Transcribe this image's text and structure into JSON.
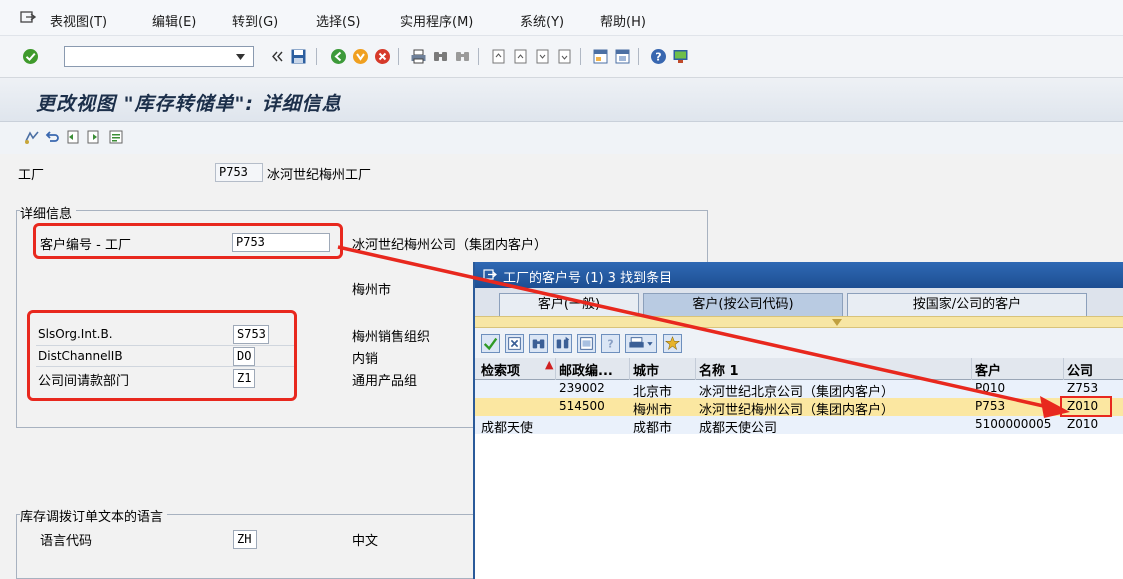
{
  "menu": {
    "items": [
      "表视图(T)",
      "编辑(E)",
      "转到(G)",
      "选择(S)",
      "实用程序(M)",
      "系统(Y)",
      "帮助(H)"
    ]
  },
  "toolbar": {
    "command_value": ""
  },
  "title": "更改视图 \"库存转储单\": 详细信息",
  "plant": {
    "label": "工厂",
    "value": "P753",
    "desc": "冰河世纪梅州工厂"
  },
  "details": {
    "group_title": "详细信息",
    "customer": {
      "label": "客户编号 - 工厂",
      "value": "P753",
      "desc": "冰河世纪梅州公司（集团内客户）",
      "city": "梅州市"
    },
    "salesorg": {
      "label": "SlsOrg.Int.B.",
      "value": "S753",
      "desc": "梅州销售组织"
    },
    "distchannel": {
      "label": "DistChannelIB",
      "value": "DO",
      "desc": "内销"
    },
    "division": {
      "label": "公司间请款部门",
      "value": "Z1",
      "desc": "通用产品组"
    }
  },
  "language": {
    "group_title": "库存调拨订单文本的语言",
    "label": "语言代码",
    "value": "ZH",
    "desc": "中文"
  },
  "popup": {
    "title": "工厂的客户号 (1)   3 找到条目",
    "tabs": [
      "客户(一般)",
      "客户(按公司代码)",
      "按国家/公司的客户"
    ],
    "columns": [
      "检索项",
      "邮政编...",
      "城市",
      "名称 1",
      "客户",
      "公司"
    ],
    "rows": [
      {
        "search": "",
        "postal": "239002",
        "city": "北京市",
        "name": "冰河世纪北京公司（集团内客户）",
        "customer": "P010",
        "company": "Z753"
      },
      {
        "search": "",
        "postal": "514500",
        "city": "梅州市",
        "name": "冰河世纪梅州公司（集团内客户）",
        "customer": "P753",
        "company": "Z010"
      },
      {
        "search": "成都天使",
        "postal": "",
        "city": "成都市",
        "name": "成都天使公司",
        "customer": "5100000005",
        "company": "Z010"
      }
    ]
  },
  "colors": {
    "highlight": "#e8281e",
    "selected_row": "#fbe7a1",
    "popup_title": "#2f69b4"
  }
}
